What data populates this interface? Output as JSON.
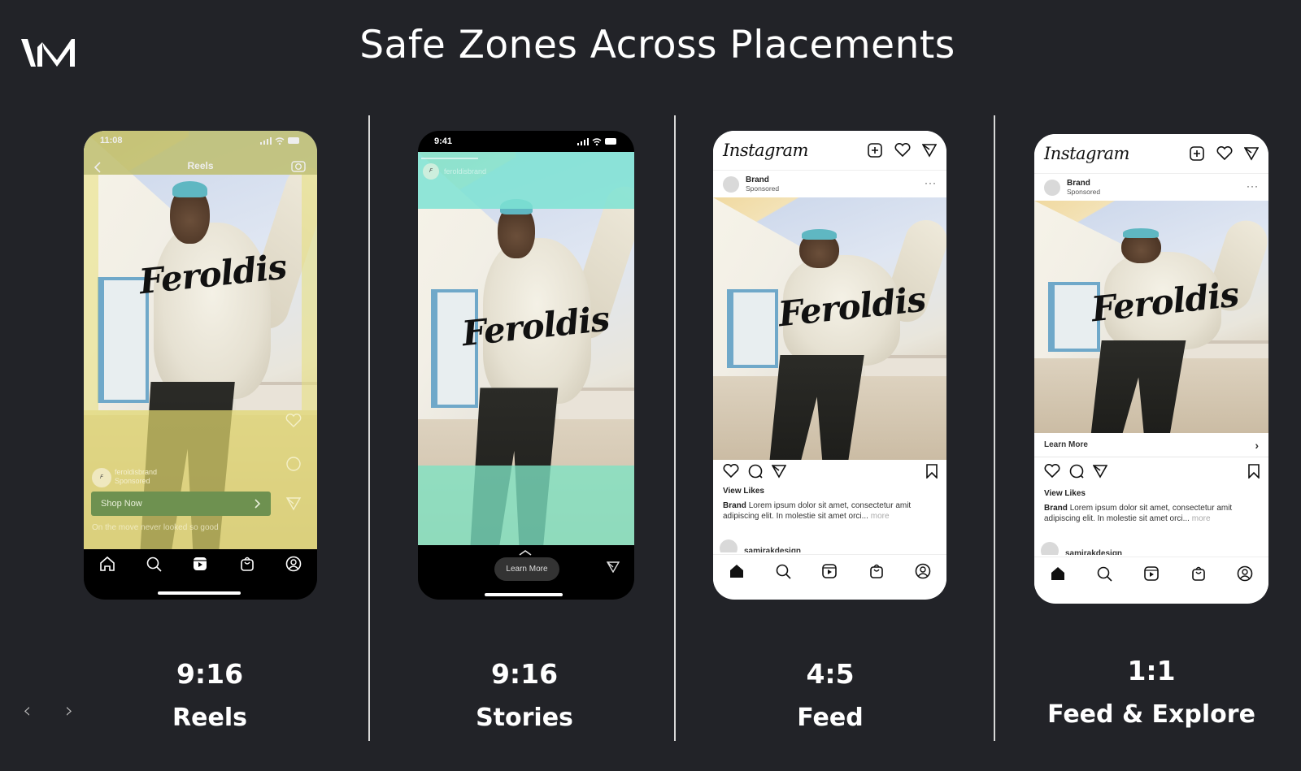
{
  "brand": {
    "logo_text": "VM",
    "logo_icon": "vm-logo"
  },
  "title": "Safe Zones Across Placements",
  "colors": {
    "background": "#222328",
    "reels_overlay": "#e8e07a",
    "reels_cta": "#6e9150",
    "stories_overlay": "#7ee3d3",
    "divider": "#d8d8d8"
  },
  "pager": {
    "prev_icon": "chevron-left-icon",
    "next_icon": "chevron-right-icon",
    "prev": "‹",
    "next": "›"
  },
  "placements": [
    {
      "id": "reels",
      "ratio": "9:16",
      "name": "Reels",
      "status_time": "11:08",
      "top_title": "Reels",
      "brandmark": "Feroldis",
      "account": "feroldisbrand",
      "sponsored": "Sponsored",
      "cta": "Shop Now",
      "caption": "On the move never looked so good",
      "side_icons": [
        "heart-icon",
        "comment-icon",
        "share-icon"
      ],
      "nav_icons": [
        "home-icon",
        "search-icon",
        "reels-icon",
        "shop-icon",
        "profile-icon"
      ]
    },
    {
      "id": "stories",
      "ratio": "9:16",
      "name": "Stories",
      "status_time": "9:41",
      "account": "feroldisbrand",
      "brandmark": "Feroldis",
      "swipe_icon": "chevron-up-icon",
      "cta": "Learn More",
      "share_icon": "send-icon"
    },
    {
      "id": "feed",
      "ratio": "4:5",
      "name": "Feed",
      "app_name": "Instagram",
      "post_account": "Brand",
      "post_sub": "Sponsored",
      "brandmark": "Feroldis",
      "view_likes": "View Likes",
      "caption_user": "Brand",
      "caption_text": "Lorem ipsum dolor sit amet, consectetur amit adipiscing elit. In molestie sit amet orci...",
      "caption_more": "more",
      "comment_user": "samirakdesign",
      "more_menu": "···",
      "nav_icons": [
        "home-icon",
        "search-icon",
        "reels-icon",
        "shop-icon",
        "profile-icon"
      ]
    },
    {
      "id": "feed-explore",
      "ratio": "1:1",
      "name": "Feed & Explore",
      "app_name": "Instagram",
      "post_account": "Brand",
      "post_sub": "Sponsored",
      "brandmark": "Feroldis",
      "cta": "Learn More",
      "cta_arrow": "›",
      "view_likes": "View Likes",
      "caption_user": "Brand",
      "caption_text": "Lorem ipsum dolor sit amet, consectetur amit adipiscing elit. In molestie sit amet orci...",
      "caption_more": "more",
      "comment_user": "samirakdesign",
      "more_menu": "···",
      "nav_icons": [
        "home-icon",
        "search-icon",
        "reels-icon",
        "shop-icon",
        "profile-icon"
      ]
    }
  ]
}
